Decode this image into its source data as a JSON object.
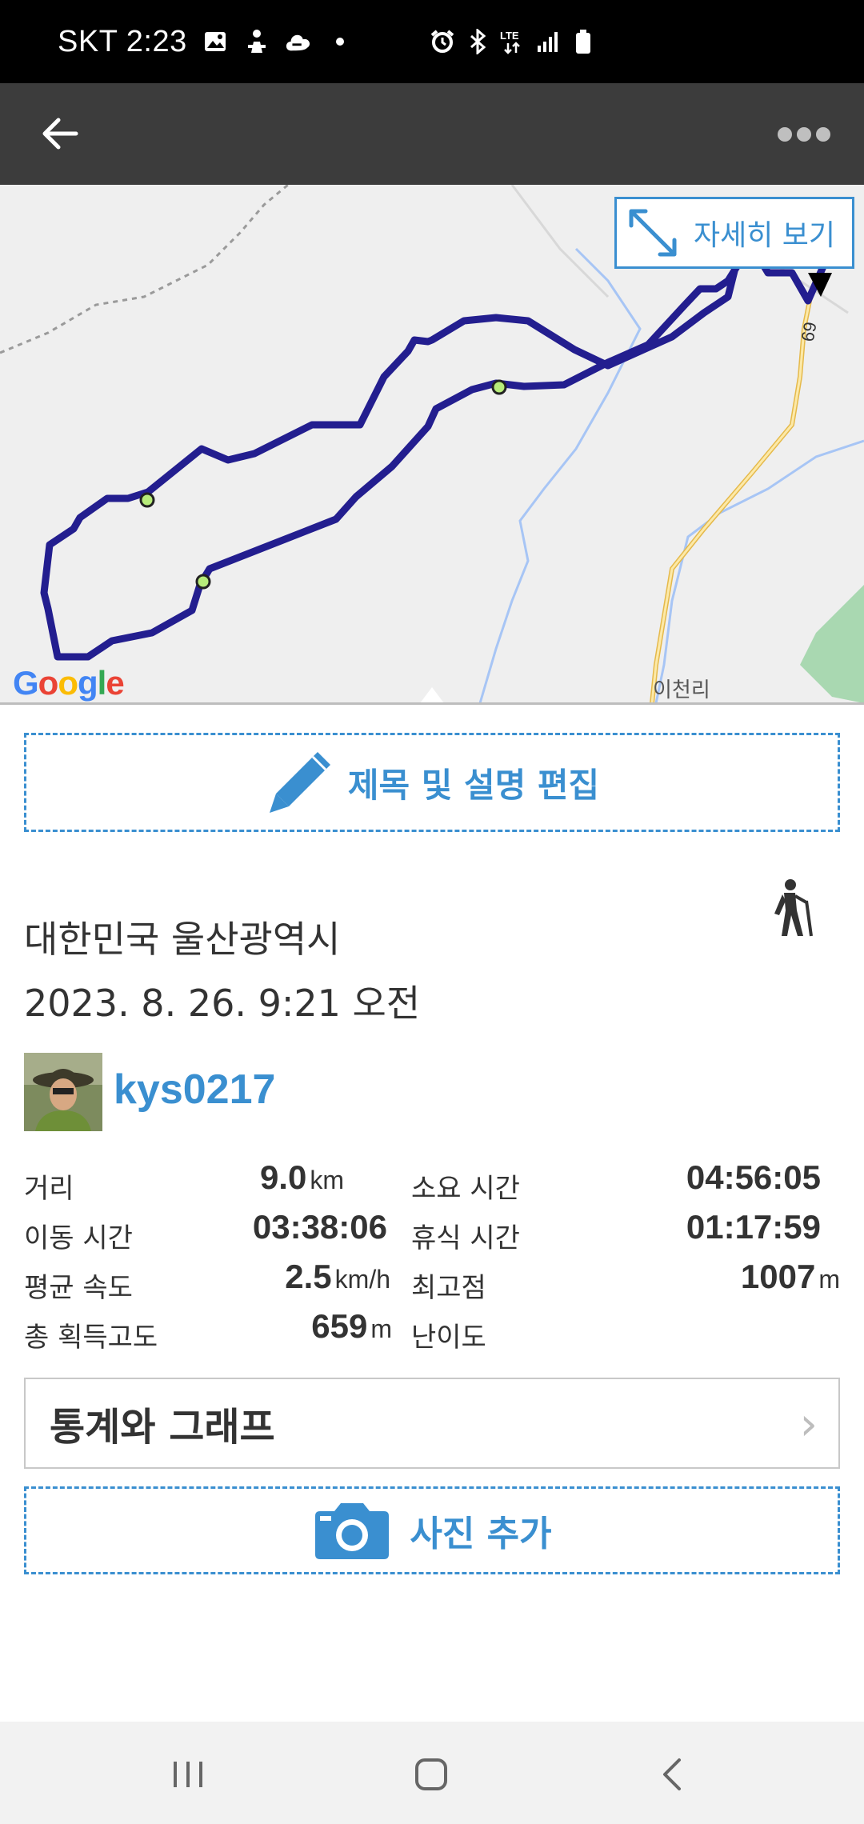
{
  "status_bar": {
    "carrier_time": "SKT 2:23",
    "icons": [
      "gallery-icon",
      "hiker-notification-icon",
      "cloud-icon",
      "dot-icon",
      "alarm-icon",
      "bluetooth-icon",
      "lte-icon",
      "signal-icon",
      "battery-icon"
    ]
  },
  "app_bar": {
    "back_icon": "arrow-left-icon",
    "more_icon": "more-dots-icon"
  },
  "map": {
    "detail_button_label": "자세히 보기",
    "google_logo": "Google",
    "place_label": "이천리",
    "road_number": "69",
    "track_color": "#231e8f"
  },
  "edit": {
    "label": "제목 및 설명 편집",
    "icon": "pencil-icon"
  },
  "activity": {
    "location": "대한민국 울산광역시",
    "datetime": "2023. 8. 26. 9:21 오전",
    "type_icon": "hiking-icon",
    "username": "kys0217"
  },
  "stats": {
    "rows": [
      {
        "label1": "거리",
        "value1": "9.0",
        "unit1": "km",
        "label2": "소요 시간",
        "value2": "04:56:05",
        "unit2": ""
      },
      {
        "label1": "이동 시간",
        "value1": "03:38:06",
        "unit1": "",
        "label2": "휴식 시간",
        "value2": "01:17:59",
        "unit2": ""
      },
      {
        "label1": "평균 속도",
        "value1": "2.5",
        "unit1": "km/h",
        "label2": "최고점",
        "value2": "1007",
        "unit2": "m"
      },
      {
        "label1": "총 획득고도",
        "value1": "659",
        "unit1": "m",
        "label2": "난이도",
        "value2": "",
        "unit2": ""
      }
    ]
  },
  "stats_button": {
    "label": "통계와 그래프",
    "chevron": "›"
  },
  "photo_button": {
    "label": "사진 추가",
    "icon": "camera-icon"
  },
  "accent_color": "#3a8fd0"
}
